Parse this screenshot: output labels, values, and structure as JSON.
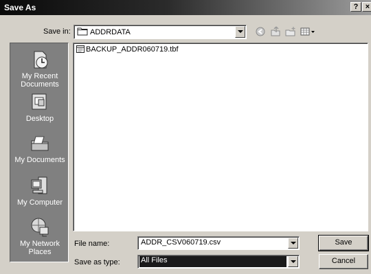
{
  "window": {
    "title": "Save As",
    "help_label": "?",
    "close_label": "×"
  },
  "toolbar": {
    "save_in_label": "Save in:",
    "save_in_value": "ADDRDATA",
    "icons": [
      "back-icon",
      "up-folder-icon",
      "new-folder-icon",
      "views-menu-icon"
    ]
  },
  "places": [
    {
      "label": "My Recent\nDocuments",
      "icon": "recent-documents-icon"
    },
    {
      "label": "Desktop",
      "icon": "desktop-icon"
    },
    {
      "label": "My Documents",
      "icon": "my-documents-icon"
    },
    {
      "label": "My Computer",
      "icon": "my-computer-icon"
    },
    {
      "label": "My Network\nPlaces",
      "icon": "network-places-icon"
    }
  ],
  "files": [
    {
      "name": "BACKUP_ADDR060719.tbf",
      "icon": "file-icon"
    }
  ],
  "form": {
    "filename_label": "File name:",
    "filename_value": "ADDR_CSV060719.csv",
    "filetype_label": "Save as type:",
    "filetype_value": "All Files"
  },
  "buttons": {
    "save_label": "Save",
    "cancel_label": "Cancel"
  }
}
